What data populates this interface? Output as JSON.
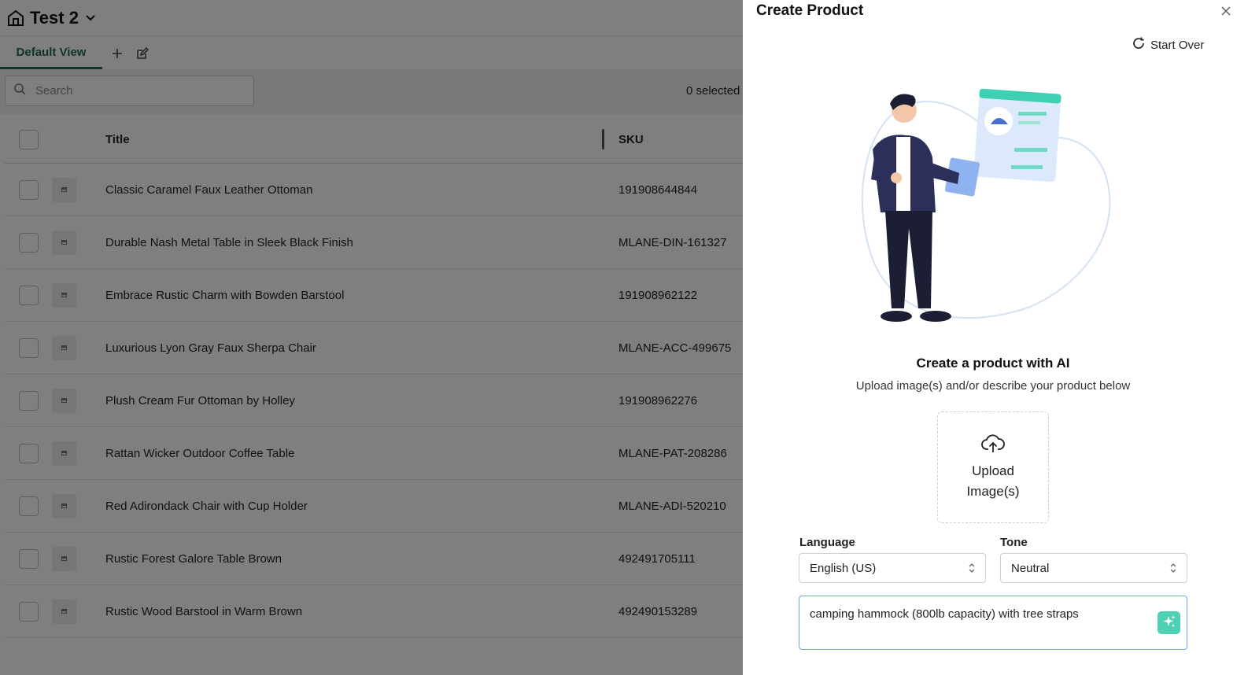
{
  "app": {
    "store_name": "Test 2",
    "view_tab": "Default View",
    "search_placeholder": "Search",
    "selected_count": "0 selected"
  },
  "table": {
    "headers": {
      "title": "Title",
      "sku": "SKU"
    },
    "rows": [
      {
        "title": "Classic Caramel Faux Leather Ottoman",
        "sku": "191908644844"
      },
      {
        "title": "Durable Nash Metal Table in Sleek Black Finish",
        "sku": "MLANE-DIN-161327"
      },
      {
        "title": "Embrace Rustic Charm with Bowden Barstool",
        "sku": "191908962122"
      },
      {
        "title": "Luxurious Lyon Gray Faux Sherpa Chair",
        "sku": "MLANE-ACC-499675"
      },
      {
        "title": "Plush Cream Fur Ottoman by Holley",
        "sku": "191908962276"
      },
      {
        "title": "Rattan Wicker Outdoor Coffee Table",
        "sku": "MLANE-PAT-208286"
      },
      {
        "title": "Red Adirondack Chair with Cup Holder",
        "sku": "MLANE-ADI-520210"
      },
      {
        "title": "Rustic Forest Galore Table Brown",
        "sku": "492491705111"
      },
      {
        "title": "Rustic Wood Barstool in Warm Brown",
        "sku": "492490153289"
      }
    ]
  },
  "drawer": {
    "title": "Create Product",
    "start_over": "Start Over",
    "heading": "Create a product with AI",
    "subheading": "Upload image(s) and/or describe your product below",
    "upload_label": "Upload Image(s)",
    "language_label": "Language",
    "language_value": "English (US)",
    "tone_label": "Tone",
    "tone_value": "Neutral",
    "description": "camping hammock (800lb capacity) with tree straps"
  },
  "colors": {
    "accent_green": "#1c6b4a",
    "ai_button": "#4fd1b4",
    "focus_border": "#6aa5ec"
  },
  "icons": [
    "store-icon",
    "chevron-down-icon",
    "plus-icon",
    "edit-icon",
    "search-icon",
    "close-icon",
    "refresh-icon",
    "upload-cloud-icon",
    "sort-caret-icon",
    "sparkle-icon"
  ]
}
